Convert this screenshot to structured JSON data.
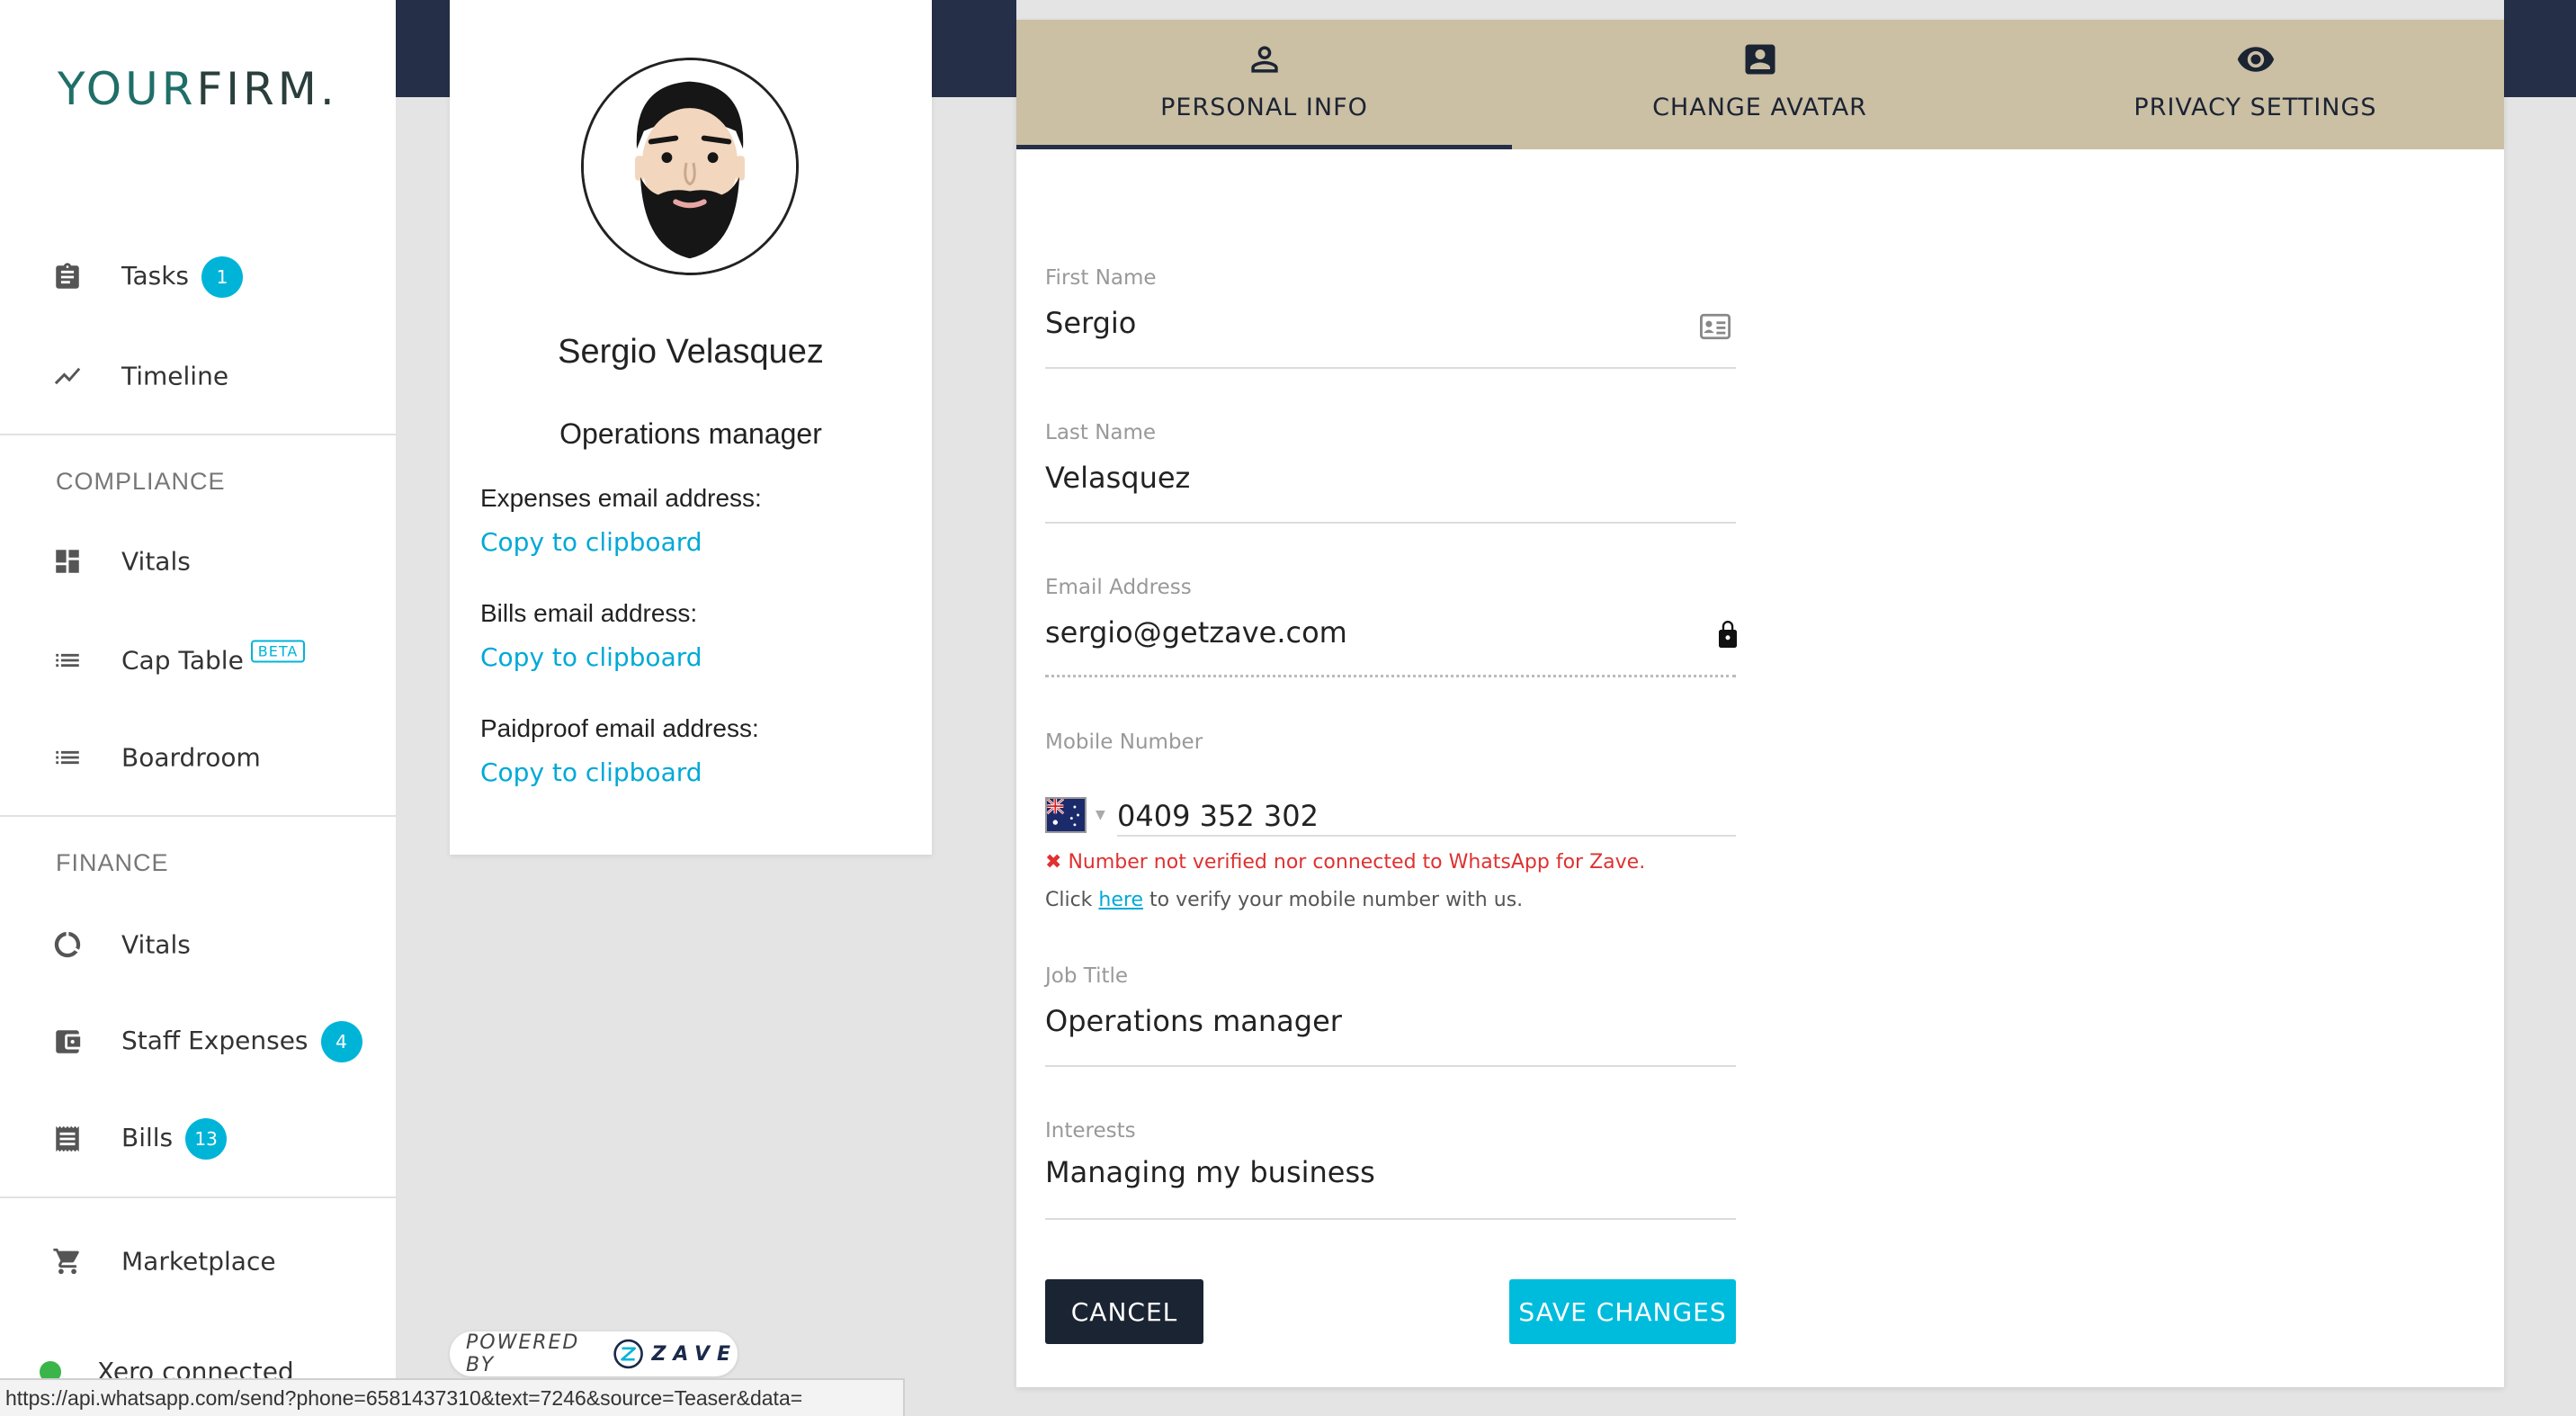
{
  "brand": {
    "your": "YOUR",
    "firm": "FIRM",
    "dot": "."
  },
  "sidebar": {
    "items": [
      {
        "label": "Tasks",
        "badge": "1",
        "icon": "clipboard-icon"
      },
      {
        "label": "Timeline",
        "icon": "trend-line-icon"
      }
    ],
    "compliance": {
      "title": "COMPLIANCE",
      "items": [
        {
          "label": "Vitals",
          "icon": "dashboard-icon"
        },
        {
          "label": "Cap Table",
          "tag": "BETA",
          "icon": "list-icon"
        },
        {
          "label": "Boardroom",
          "icon": "list-icon"
        }
      ]
    },
    "finance": {
      "title": "FINANCE",
      "items": [
        {
          "label": "Vitals",
          "icon": "donut-icon"
        },
        {
          "label": "Staff Expenses",
          "badge": "4",
          "icon": "wallet-icon"
        },
        {
          "label": "Bills",
          "badge": "13",
          "icon": "receipt-icon"
        }
      ]
    },
    "marketplace": {
      "label": "Marketplace",
      "icon": "cart-icon"
    },
    "xero": {
      "label": "Xero connected"
    }
  },
  "profile": {
    "name": "Sergio Velasquez",
    "role": "Operations manager",
    "emails": [
      {
        "label": "Expenses email address:",
        "link": "Copy to clipboard"
      },
      {
        "label": "Bills email address:",
        "link": "Copy to clipboard"
      },
      {
        "label": "Paidproof email address:",
        "link": "Copy to clipboard"
      }
    ]
  },
  "powered": {
    "prefix": "POWERED BY",
    "brand": "ZAVE"
  },
  "status_url": "https://api.whatsapp.com/send?phone=6581437310&text=7246&source=Teaser&data=",
  "tabs": [
    {
      "label": "PERSONAL INFO",
      "icon": "person-icon",
      "active": true
    },
    {
      "label": "CHANGE AVATAR",
      "icon": "account-box-icon",
      "active": false
    },
    {
      "label": "PRIVACY SETTINGS",
      "icon": "eye-icon",
      "active": false
    }
  ],
  "form": {
    "first_name": {
      "label": "First Name",
      "value": "Sergio"
    },
    "last_name": {
      "label": "Last Name",
      "value": "Velasquez"
    },
    "email": {
      "label": "Email Address",
      "value": "sergio@getzave.com"
    },
    "mobile": {
      "label": "Mobile Number",
      "value": "0409 352 302",
      "country": "AU"
    },
    "mobile_error": "Number not verified nor connected to WhatsApp for Zave.",
    "mobile_hint": {
      "prefix": "Click ",
      "link": "here",
      "suffix": " to verify your mobile number with us."
    },
    "job_title": {
      "label": "Job Title",
      "value": "Operations manager"
    },
    "interests": {
      "label": "Interests",
      "value": "Managing my business"
    }
  },
  "buttons": {
    "cancel": "CANCEL",
    "save": "SAVE CHANGES"
  },
  "colors": {
    "accent": "#00b4d8",
    "navy": "#262f48",
    "tab_bg": "#cbbfa4",
    "error": "#e03030"
  }
}
